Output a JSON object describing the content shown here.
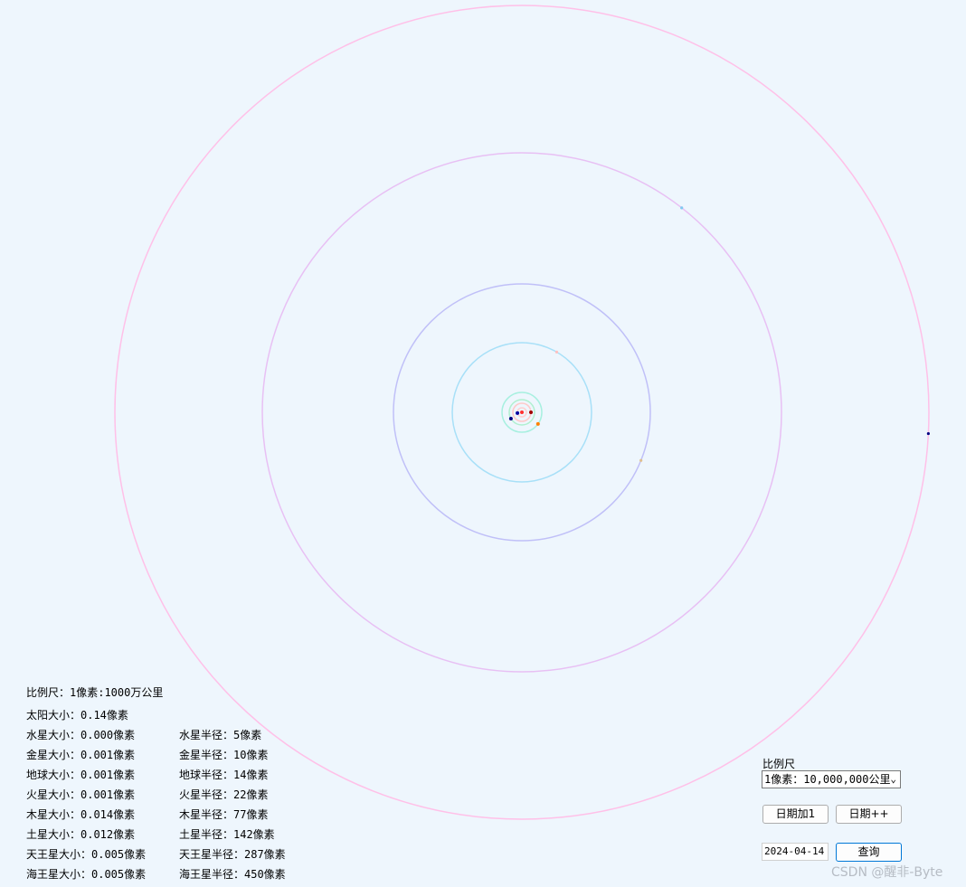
{
  "scale_title": "比例尺：1像素:1000万公里",
  "sun_size": "太阳大小：0.14像素",
  "planets": [
    {
      "size_text": "水星大小：0.000像素",
      "radius_text": "水星半径：5像素",
      "orbit": 5,
      "angle": 170,
      "color": "#ffd0d0",
      "dot": "#0000a0"
    },
    {
      "size_text": "金星大小：0.001像素",
      "radius_text": "金星半径：10像素",
      "orbit": 10,
      "angle": 0,
      "color": "#ffc8c8",
      "dot": "#a00000"
    },
    {
      "size_text": "地球大小：0.001像素",
      "radius_text": "地球半径：14像素",
      "orbit": 14,
      "angle": 150,
      "color": "#b0f0d0",
      "dot": "#000080"
    },
    {
      "size_text": "火星大小：0.001像素",
      "radius_text": "火星半径：22像素",
      "orbit": 22,
      "angle": 36,
      "color": "#a8f0e0",
      "dot": "#ff8000"
    },
    {
      "size_text": "木星大小：0.014像素",
      "radius_text": "木星半径：77像素",
      "orbit": 77,
      "angle": -60,
      "color": "#a8e0f8",
      "dot": "#ffc0c0"
    },
    {
      "size_text": "土星大小：0.012像素",
      "radius_text": "土星半径：142像素",
      "orbit": 142,
      "angle": 22,
      "color": "#c0c0f8",
      "dot": "#e0c090"
    },
    {
      "size_text": "天王星大小：0.005像素",
      "radius_text": "天王星半径：287像素",
      "orbit": 287,
      "angle": -52,
      "color": "#e8c0f4",
      "dot": "#80c8f0"
    },
    {
      "size_text": "海王星大小：0.005像素",
      "radius_text": "海王星半径：450像素",
      "orbit": 450,
      "angle": 3,
      "color": "#ffc0e8",
      "dot": "#000080"
    }
  ],
  "controls": {
    "scale_label": "比例尺",
    "scale_selected": "1像素：10,000,000公里",
    "day_plus_button": "日期加1",
    "day_loop_button": "日期++",
    "date_value": "2024-04-14",
    "query_button": "查询"
  },
  "watermark": "CSDN @醒非-Byte"
}
